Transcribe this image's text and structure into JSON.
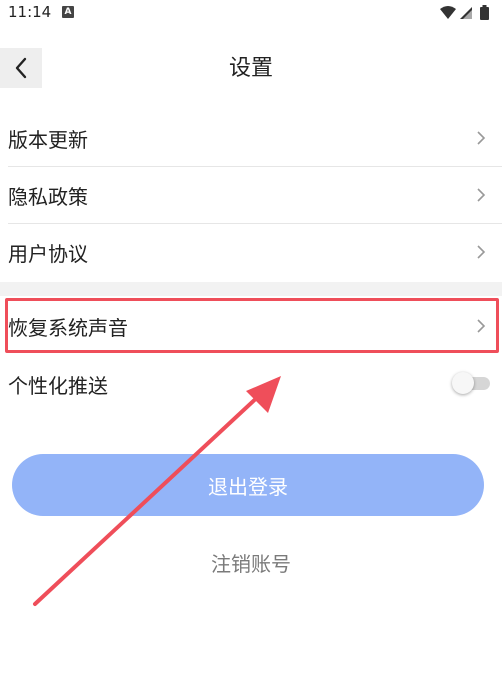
{
  "status_bar": {
    "time": "11:14",
    "app_badge": "A",
    "icons": [
      "wifi-icon",
      "signal-icon",
      "battery-icon"
    ]
  },
  "header": {
    "title": "设置",
    "back_icon": "chevron-left-icon"
  },
  "settings": {
    "items": [
      {
        "label": "版本更新",
        "icon": "chevron-right-icon"
      },
      {
        "label": "隐私政策",
        "icon": "chevron-right-icon"
      },
      {
        "label": "用户协议",
        "icon": "chevron-right-icon"
      },
      {
        "label": "恢复系统声音",
        "icon": "chevron-right-icon",
        "highlighted": true
      },
      {
        "label": "个性化推送",
        "toggle": false
      }
    ]
  },
  "actions": {
    "logout_label": "退出登录",
    "cancel_account_label": "注销账号"
  },
  "colors": {
    "logout_button": "#93b4f8",
    "highlight_border": "#ef4e5a",
    "arrow": "#ef4e5a",
    "section_gap": "#f2f2f2"
  }
}
